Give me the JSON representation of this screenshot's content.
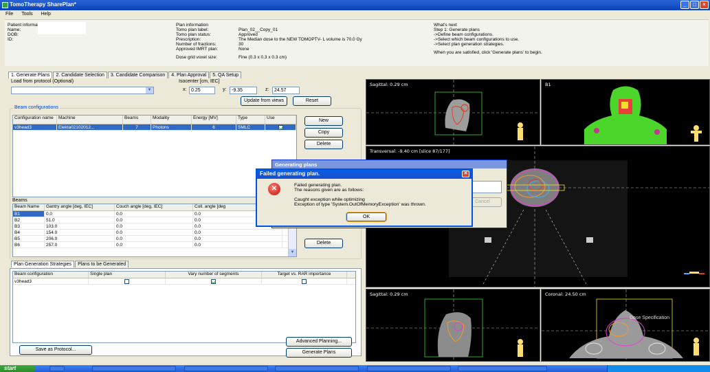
{
  "window": {
    "title": "TomoTherapy SharePlan*",
    "buttons": [
      "_",
      "□",
      "×"
    ]
  },
  "menu": [
    "File",
    "Tools",
    "Help"
  ],
  "patient": {
    "title": "Patient information",
    "labels": [
      "Name:",
      "DOB:",
      "ID:"
    ]
  },
  "plan_info": {
    "title": "Plan information",
    "labels": [
      "Tomo plan label:",
      "Tomo plan status:",
      "Prescription:",
      "Number of fractions:",
      "Approved IMRT plan:",
      "Dose grid voxel size:"
    ],
    "values": [
      "Plan_02__Copy_01",
      "Approved",
      "The Median dose to the NEW TOMOPTV- L volume is 70.0 Gy",
      "30",
      "None",
      "Fine (0.3 x 0.3 x 0.3 cm)"
    ]
  },
  "whats_next": {
    "title": "What's next",
    "lines": [
      "Step 1: Generate plans",
      "->Define beam configurations.",
      "->Select which beam configurations to use.",
      "->Select plan generation strategies."
    ],
    "footer": "When you are satisfied, click 'Generate plans' to begin."
  },
  "tabs": [
    "1. Generate Plans",
    "2. Candidate Selection",
    "3. Candidate Comparison",
    "4. Plan Approval",
    "5. QA Setup"
  ],
  "protocol": {
    "label": "Load from protocol (Optional)",
    "value": ""
  },
  "isocenter": {
    "label": "Isocenter [cm, IEC]",
    "x_label": "x:",
    "x": "0.25",
    "y_label": "y:",
    "y": "-9.35",
    "z_label": "z:",
    "z": "24.57"
  },
  "buttons": {
    "update_from_views": "Update from views",
    "reset": "Reset",
    "new": "New",
    "copy": "Copy",
    "delete": "Delete",
    "delete2": "Delete",
    "advanced_planning": "Advanced Planning...",
    "generate_plans": "Generate Plans",
    "save_as_protocol": "Save as Protocol..."
  },
  "beam_configs": {
    "title": "Beam configurations",
    "headers": [
      "Configuration name",
      "Machine",
      "Beams",
      "Modality",
      "Energy [MV]",
      "Type",
      "Use"
    ],
    "rows": [
      [
        "v3head3",
        "Elekta02102012...",
        "7",
        "Photons",
        "6",
        "SMLC"
      ]
    ]
  },
  "beams": {
    "title": "Beams",
    "headers": [
      "Beam Name",
      "Gantry angle [deg, IEC]",
      "Couch angle [deg, IEC]",
      "Coll. angle [deg"
    ],
    "rows": [
      [
        "B1",
        "0.0",
        "0.0",
        "0.0"
      ],
      [
        "B2",
        "51.0",
        "0.0",
        "0.0"
      ],
      [
        "B3",
        "103.0",
        "0.0",
        "0.0"
      ],
      [
        "B4",
        "154.0",
        "0.0",
        "0.0"
      ],
      [
        "B5",
        "206.0",
        "0.0",
        "0.0"
      ],
      [
        "B6",
        "257.0",
        "0.0",
        "0.0"
      ]
    ]
  },
  "strategy_tabs": [
    "Plan Generation Strategies",
    "Plans to be Generated"
  ],
  "strategies": {
    "headers": [
      "Beam configuration",
      "Single plan",
      "Vary number of segments",
      "Target vs. RAR importance"
    ],
    "rows": [
      {
        "name": "v3head3",
        "single": false,
        "vary": true,
        "target": false
      }
    ]
  },
  "viewers": {
    "sagittal_top": "Sagittal: 0.29 cm",
    "b1": "B1",
    "transversal": "Transversal: -9.40 cm  [slice 87/177]",
    "sagittal_bottom": "Sagittal: 0.29 cm",
    "coronal": "Coronal: 24.50 cm",
    "dose_spec": "Dose Specification"
  },
  "dialog_back": {
    "title": "Generating plans",
    "cancel": "Cancel"
  },
  "dialog": {
    "title": "Failed generating plan.",
    "line1": "Failed generating plan.",
    "line2": "The reasons given are as follows:",
    "line3": "Caught exception while optimizing",
    "line4": "Exception of type 'System.OutOfMemoryException' was thrown.",
    "ok": "OK"
  },
  "taskbar": {
    "start": "start"
  }
}
